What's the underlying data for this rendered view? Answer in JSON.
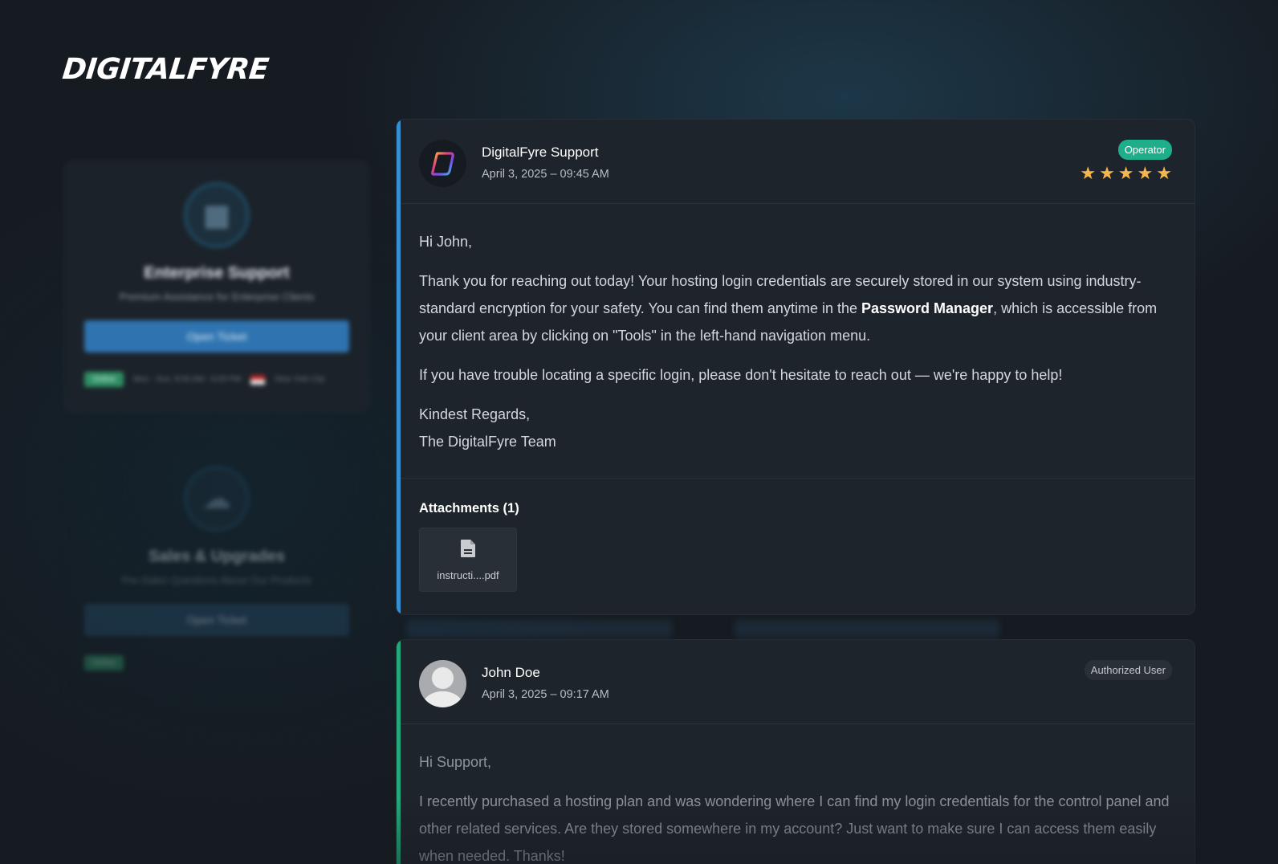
{
  "brand": {
    "logo_text": "DIGITALFYRE"
  },
  "sidebar": {
    "cards": [
      {
        "title": "Enterprise Support",
        "subtitle": "Premium Assistance for Enterprise Clients",
        "button_label": "Open Ticket",
        "status_badge": "Online",
        "hours": "Mon - Sun, 8:00 AM - 8:00 PM",
        "location": "New York City",
        "icon": "building-icon"
      },
      {
        "title": "Sales & Upgrades",
        "subtitle": "Pre-Sales Questions About Our Products",
        "button_label": "Open Ticket",
        "status_badge": "Online",
        "icon": "cloud-icon"
      }
    ]
  },
  "thread": {
    "messages": [
      {
        "author": "DigitalFyre Support",
        "date": "April 3, 2025 – 09:45 AM",
        "role_tag": "Operator",
        "rating_stars": 5,
        "greeting": "Hi John,",
        "para1_a": "Thank you for reaching out today! Your hosting login credentials are securely stored in our system using industry-standard encryption for your safety. You can find them anytime in the ",
        "para1_bold": "Password Manager",
        "para1_b": ", which is accessible from your client area by clicking on \"Tools\" in the left-hand navigation menu.",
        "para2": "If you have trouble locating a specific login, please don't hesitate to reach out — we're happy to help!",
        "sign_line1": "Kindest Regards,",
        "sign_line2": "The DigitalFyre Team",
        "attachments_title": "Attachments (1)",
        "attachments": [
          {
            "name": "instructi....pdf",
            "icon": "document-icon"
          }
        ],
        "accent_color": "#3590d1"
      },
      {
        "author": "John Doe",
        "date": "April 3, 2025 – 09:17 AM",
        "role_tag": "Authorized User",
        "greeting": "Hi Support,",
        "para1": "I recently purchased a hosting plan and was wondering where I can find my login credentials for the control panel and other related services. Are they stored somewhere in my account? Just want to make sure I can access them easily when needed. Thanks!",
        "accent_color": "#22a87a"
      }
    ]
  },
  "colors": {
    "operator_tag": "#1fae8a",
    "star": "#f5b74b",
    "background": "#161b21"
  }
}
